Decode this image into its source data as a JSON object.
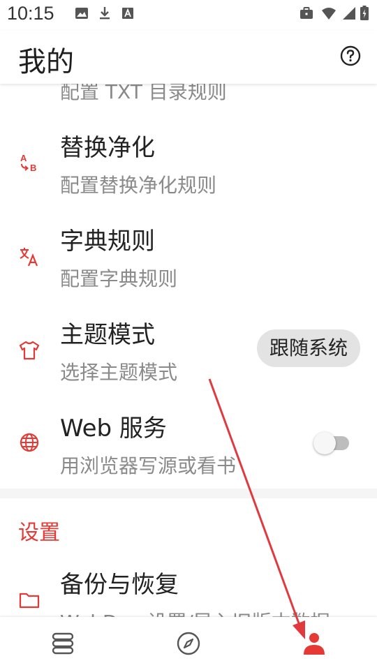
{
  "status_bar": {
    "time": "10:15",
    "icons": [
      "image-icon",
      "download-icon",
      "font-icon",
      "briefcase-icon",
      "wifi-icon",
      "signal-icon",
      "battery-icon"
    ]
  },
  "app_bar": {
    "title": "我的",
    "help_icon": "help-circle-icon"
  },
  "list": {
    "partial_item": {
      "subtitle": "配置 TXT 目录规则"
    },
    "items": [
      {
        "title": "替换净化",
        "subtitle": "配置替换净化规则",
        "icon": "replace-ab-icon"
      },
      {
        "title": "字典规则",
        "subtitle": "配置字典规则",
        "icon": "translate-icon"
      },
      {
        "title": "主题模式",
        "subtitle": "选择主题模式",
        "icon": "tshirt-icon",
        "value": "跟随系统"
      },
      {
        "title": "Web 服务",
        "subtitle": "用浏览器写源或看书",
        "icon": "globe-icon",
        "switch_on": false
      },
      {
        "title": "备份与恢复",
        "subtitle": "WebDav 设置/导入旧版本数据",
        "icon": "folder-icon"
      }
    ]
  },
  "section": {
    "settings_header": "设置"
  },
  "bottom_nav": {
    "items": [
      {
        "name": "bookshelf",
        "icon": "bookshelf-icon",
        "active": false
      },
      {
        "name": "explore",
        "icon": "compass-icon",
        "active": false
      },
      {
        "name": "my",
        "icon": "person-icon",
        "active": true
      }
    ]
  },
  "colors": {
    "accent": "#e53935",
    "primary_text": "#222222",
    "secondary_text": "#8a8a8a",
    "nav_inactive": "#555555",
    "annotation_arrow": "#e0393e"
  }
}
